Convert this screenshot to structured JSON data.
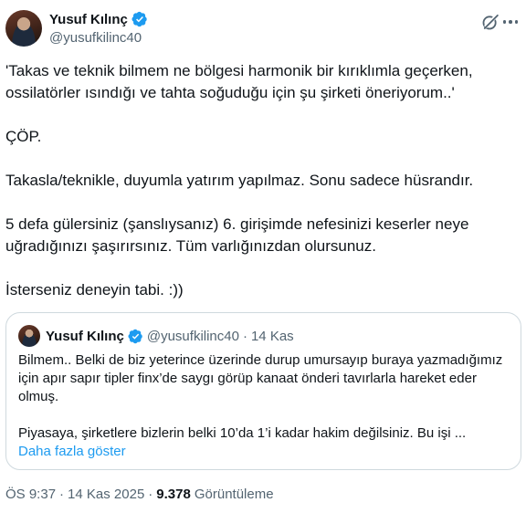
{
  "author": {
    "name": "Yusuf Kılınç",
    "handle": "@yusufkilinc40"
  },
  "tweet": {
    "paragraphs": [
      "'Takas ve teknik bilmem ne bölgesi harmonik bir kırıklımla geçerken, ossilatörler ısındığı ve tahta soğuduğu için şu şirketi öneriyorum..'",
      "ÇÖP.",
      "Takasla/teknikle, duyumla yatırım yapılmaz. Sonu sadece hüsrandır.",
      "5 defa gülersiniz (şanslıysanız) 6. girişimde nefesinizi keserler neye uğradığınızı şaşırırsınız. Tüm varlığınızdan olursunuz.",
      "İsterseniz deneyin tabi. :))"
    ]
  },
  "quote": {
    "name": "Yusuf Kılınç",
    "handle": "@yusufkilinc40",
    "separator": "·",
    "date": "14 Kas",
    "paragraphs": [
      "Bilmem.. Belki de biz yeterince üzerinde durup umursayıp buraya yazmadığımız için apır sapır tipler finx’de saygı görüp kanaat önderi tavırlarla hareket eder olmuş.",
      "Piyasaya, şirketlere bizlerin belki 10’da 1’i kadar hakim değilsiniz. Bu işi ..."
    ],
    "show_more": "Daha fazla göster"
  },
  "meta": {
    "time": "ÖS 9:37",
    "separator1": "·",
    "date": "14 Kas 2025",
    "separator2": "·",
    "views_count": "9.378",
    "views_label": "Görüntüleme"
  },
  "icons": {
    "verified": "verified-badge-icon",
    "grok": "grok-icon",
    "more": "more-icon"
  },
  "colors": {
    "accent": "#1d9bf0",
    "secondary_text": "#536471",
    "primary_text": "#0f1419",
    "border": "#cfd9de"
  }
}
